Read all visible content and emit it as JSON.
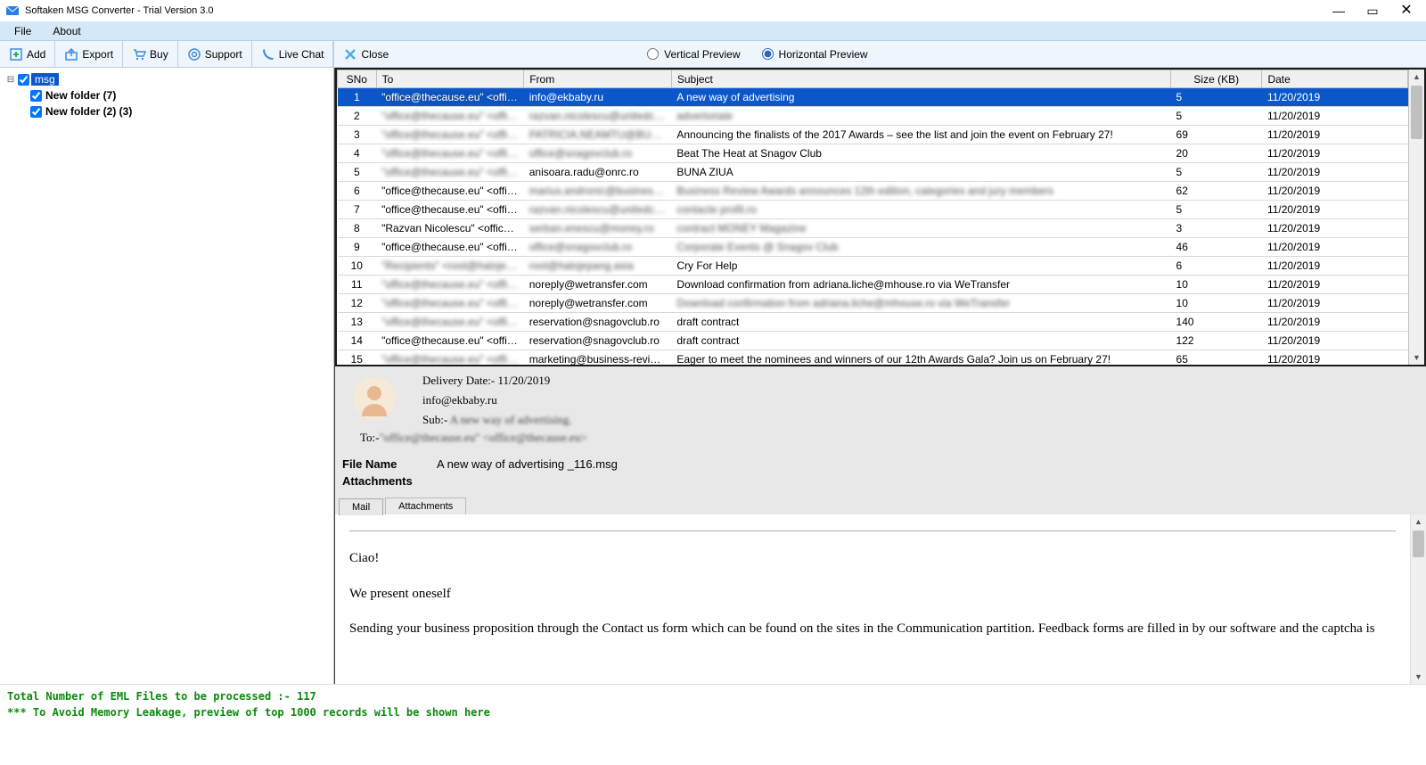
{
  "window": {
    "title": "Softaken MSG Converter - Trial Version 3.0"
  },
  "menubar": {
    "file": "File",
    "about": "About"
  },
  "toolbar": {
    "add": "Add",
    "export": "Export",
    "buy": "Buy",
    "support": "Support",
    "live_chat": "Live Chat",
    "close": "Close",
    "vertical_preview": "Vertical Preview",
    "horizontal_preview": "Horizontal Preview"
  },
  "tree": {
    "root": "msg",
    "children": [
      "New folder (7)",
      "New folder (2) (3)"
    ]
  },
  "grid": {
    "headers": {
      "sno": "SNo",
      "to": "To",
      "from": "From",
      "subject": "Subject",
      "size": "Size (KB)",
      "date": "Date"
    },
    "rows": [
      {
        "sno": 1,
        "to": "\"office@thecause.eu\" <office...",
        "from": "info@ekbaby.ru",
        "subject": "A new way of advertising",
        "size": 5,
        "date": "11/20/2019",
        "blur_to": true,
        "blur_from": false,
        "blur_subject": false
      },
      {
        "sno": 2,
        "to": "\"office@thecause.eu\" <office...",
        "from": "razvan.nicolescu@unitedcom...",
        "subject": "advertoriale",
        "size": 5,
        "date": "11/20/2019",
        "blur_to": true,
        "blur_from": true,
        "blur_subject": true
      },
      {
        "sno": 3,
        "to": "\"office@thecause.eu\" <office...",
        "from": "PATRICIA.NEAMTU@BUSIN...",
        "subject": "Announcing the finalists of the 2017 Awards – see the list and join the event on February 27!",
        "size": 69,
        "date": "11/20/2019",
        "blur_to": true,
        "blur_from": true,
        "blur_subject": false
      },
      {
        "sno": 4,
        "to": "\"office@thecause.eu\" <office...",
        "from": "office@snagovclub.ro",
        "subject": "Beat The Heat at Snagov Club",
        "size": 20,
        "date": "11/20/2019",
        "blur_to": true,
        "blur_from": true,
        "blur_subject": false
      },
      {
        "sno": 5,
        "to": "\"office@thecause.eu\" <office...",
        "from": "anisoara.radu@onrc.ro",
        "subject": "BUNA ZIUA",
        "size": 5,
        "date": "11/20/2019",
        "blur_to": true,
        "blur_from": false,
        "blur_subject": false
      },
      {
        "sno": 6,
        "to": "\"office@thecause.eu\" <office...",
        "from": "marius.andronic@business-rev...",
        "subject": "Business Review Awards announces 12th edition, categories and jury members",
        "size": 62,
        "date": "11/20/2019",
        "blur_to": false,
        "blur_from": true,
        "blur_subject": true
      },
      {
        "sno": 7,
        "to": "\"office@thecause.eu\" <office...",
        "from": "razvan.nicolescu@unitedcom...",
        "subject": "contacte profit.ro",
        "size": 5,
        "date": "11/20/2019",
        "blur_to": false,
        "blur_from": true,
        "blur_subject": true
      },
      {
        "sno": 8,
        "to": "\"Razvan Nicolescu\" <office@...",
        "from": "serban.enescu@money.ro",
        "subject": "contract MONEY Magazine",
        "size": 3,
        "date": "11/20/2019",
        "blur_to": false,
        "blur_from": true,
        "blur_subject": true
      },
      {
        "sno": 9,
        "to": "\"office@thecause.eu\" <office...",
        "from": "office@snagovclub.ro",
        "subject": "Corporate Events @ Snagov Club",
        "size": 46,
        "date": "11/20/2019",
        "blur_to": false,
        "blur_from": true,
        "blur_subject": true
      },
      {
        "sno": 10,
        "to": "\"Recipients\" <root@halojepa...",
        "from": "root@halojepang.asia",
        "subject": "Cry For Help",
        "size": 6,
        "date": "11/20/2019",
        "blur_to": true,
        "blur_from": true,
        "blur_subject": false
      },
      {
        "sno": 11,
        "to": "\"office@thecause.eu\" <office...",
        "from": "noreply@wetransfer.com",
        "subject": "Download confirmation from adriana.liche@mhouse.ro via WeTransfer",
        "size": 10,
        "date": "11/20/2019",
        "blur_to": true,
        "blur_from": false,
        "blur_subject": false
      },
      {
        "sno": 12,
        "to": "\"office@thecause.eu\" <office...",
        "from": "noreply@wetransfer.com",
        "subject": "Download confirmation from adriana.liche@mhouse.ro via WeTransfer",
        "size": 10,
        "date": "11/20/2019",
        "blur_to": true,
        "blur_from": false,
        "blur_subject": true
      },
      {
        "sno": 13,
        "to": "\"office@thecause.eu\" <office...",
        "from": "reservation@snagovclub.ro",
        "subject": "draft contract",
        "size": 140,
        "date": "11/20/2019",
        "blur_to": true,
        "blur_from": false,
        "blur_subject": false
      },
      {
        "sno": 14,
        "to": "\"office@thecause.eu\" <office...",
        "from": "reservation@snagovclub.ro",
        "subject": "draft contract",
        "size": 122,
        "date": "11/20/2019",
        "blur_to": false,
        "blur_from": false,
        "blur_subject": false
      },
      {
        "sno": 15,
        "to": "\"office@thecause.eu\" <office...",
        "from": "marketing@business-review.eu",
        "subject": "Eager to meet the nominees and winners of our 12th Awards Gala? Join us on February 27!",
        "size": 65,
        "date": "11/20/2019",
        "blur_to": true,
        "blur_from": false,
        "blur_subject": false
      }
    ]
  },
  "preview": {
    "delivery_label": "Delivery Date:- ",
    "delivery_date": "11/20/2019",
    "from": "info@ekbaby.ru",
    "sub_label": "Sub:- ",
    "subject": "A new way of advertising.",
    "to_label": "To:-",
    "to": "\"office@thecause.eu\" <office@thecause.eu>",
    "file_name_label": "File Name",
    "file_name": "A new way of advertising _116.msg",
    "attachments_label": "Attachments",
    "tabs": {
      "mail": "Mail",
      "attachments": "Attachments"
    },
    "body": {
      "p1": "Ciao!",
      "p2": "We present oneself",
      "p3": "Sending your business proposition through the Contact us form which can be found on the sites in the Communication partition. Feedback forms are filled in by our software and the captcha is"
    }
  },
  "status": {
    "line1_label": "Total Number of EML Files to be processed :-   ",
    "line1_value": "117",
    "line2": "*** To Avoid Memory Leakage, preview of top 1000 records will be shown here"
  }
}
